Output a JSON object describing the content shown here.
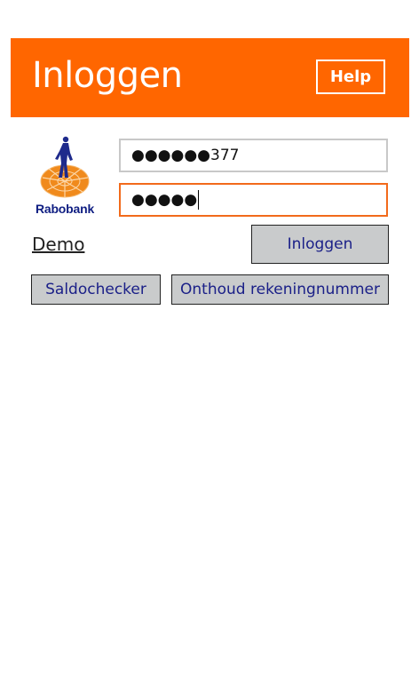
{
  "header": {
    "title": "Inloggen",
    "help_label": "Help",
    "background_color": "#ff6600"
  },
  "logo": {
    "brand_text": "Rabobank",
    "icon": "rabobank-logo-icon"
  },
  "form": {
    "account_value": "●●●●●●377",
    "password_value": "●●●●●",
    "password_focused_border": "#f26a1b"
  },
  "actions": {
    "demo_label": "Demo",
    "login_label": "Inloggen",
    "saldochecker_label": "Saldochecker",
    "onthoud_label": "Onthoud rekeningnummer"
  },
  "colors": {
    "accent": "#ff6600",
    "button_bg": "#c9cbcc",
    "button_text": "#1b2088",
    "brand_blue": "#0f1e82"
  }
}
